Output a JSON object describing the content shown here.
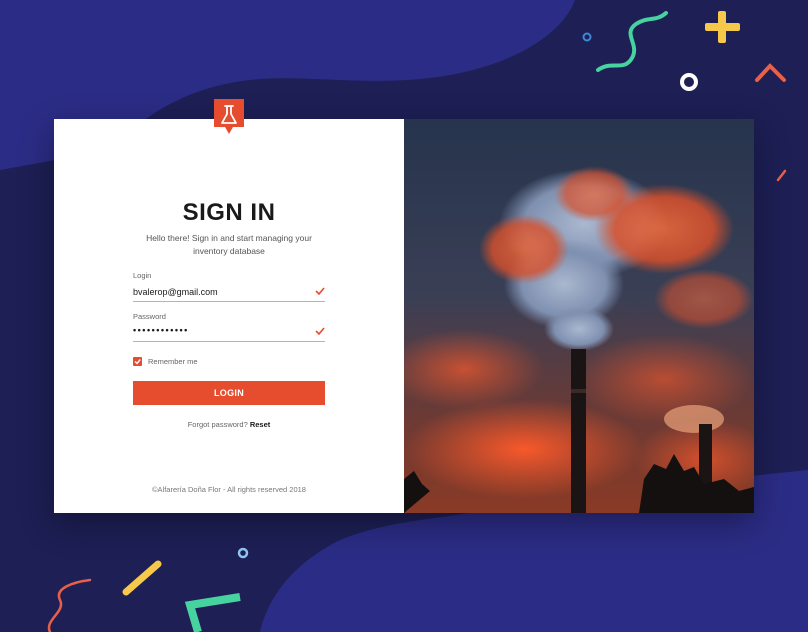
{
  "login_card": {
    "title": "SIGN IN",
    "subtitle": "Hello there! Sign in and start managing your inventory database",
    "login_field": {
      "label": "Login",
      "value": "bvalerop@gmail.com"
    },
    "password_field": {
      "label": "Password",
      "value": "••••••••••••"
    },
    "remember": {
      "label": "Remember me",
      "checked": true
    },
    "login_button": {
      "label": "LOGIN"
    },
    "forgot": {
      "text": "Forgot password?",
      "link": "Reset"
    },
    "footer": "©Alfarería Doña Flor - All rights reserved 2018"
  },
  "icons": {
    "logo": "flask-icon",
    "field_valid": "checkmark-icon",
    "remember_box": "checkbox-checked-icon"
  },
  "colors": {
    "background": "#1d1f55",
    "blob": "#2b2c85",
    "accent": "#e64c2e",
    "confetti_green": "#47d3a0",
    "confetti_yellow": "#f7c94a",
    "confetti_orange": "#e8604a"
  }
}
